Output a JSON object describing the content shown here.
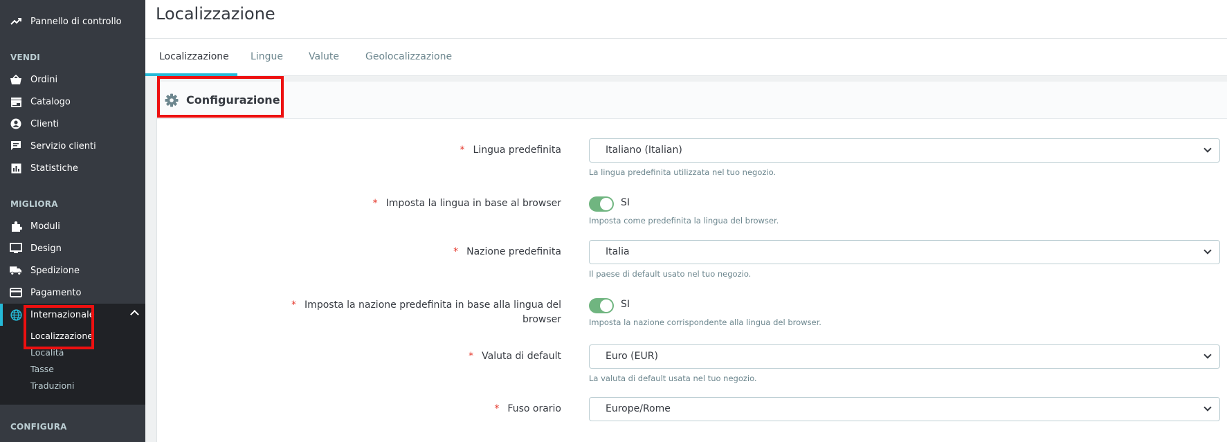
{
  "sidebar": {
    "dashboard": "Pannello di controllo",
    "sections": {
      "sell": "VENDI",
      "improve": "MIGLIORA",
      "configure": "CONFIGURA"
    },
    "sell_items": [
      {
        "label": "Ordini",
        "icon": "basket-icon"
      },
      {
        "label": "Catalogo",
        "icon": "store-icon"
      },
      {
        "label": "Clienti",
        "icon": "user-circle-icon"
      },
      {
        "label": "Servizio clienti",
        "icon": "chat-icon"
      },
      {
        "label": "Statistiche",
        "icon": "bar-chart-icon"
      }
    ],
    "improve_items": [
      {
        "label": "Moduli",
        "icon": "puzzle-icon"
      },
      {
        "label": "Design",
        "icon": "monitor-icon"
      },
      {
        "label": "Spedizione",
        "icon": "truck-icon"
      },
      {
        "label": "Pagamento",
        "icon": "credit-card-icon"
      },
      {
        "label": "Internazionale",
        "icon": "globe-icon"
      }
    ],
    "international_sub": [
      "Localizzazione",
      "Località",
      "Tasse",
      "Traduzioni"
    ]
  },
  "header": {
    "title": "Localizzazione"
  },
  "tabs": [
    "Localizzazione",
    "Lingue",
    "Valute",
    "Geolocalizzazione"
  ],
  "panel": {
    "title": "Configurazione",
    "required_mark": "*",
    "fields": {
      "default_language": {
        "label": "Lingua predefinita",
        "value": "Italiano (Italian)",
        "help": "La lingua predefinita utilizzata nel tuo negozio."
      },
      "browser_language": {
        "label": "Imposta la lingua in base al browser",
        "value": "SI",
        "help": "Imposta come predefinita la lingua del browser."
      },
      "default_country": {
        "label": "Nazione predefinita",
        "value": "Italia",
        "help": "Il paese di default usato nel tuo negozio."
      },
      "browser_country": {
        "label_line1": "Imposta la nazione predefinita in base alla lingua del",
        "label_line2": "browser",
        "value": "SI",
        "help": "Imposta la nazione corrispondente alla lingua del browser."
      },
      "default_currency": {
        "label": "Valuta di default",
        "value": "Euro (EUR)",
        "help": "La valuta di default usata nel tuo negozio."
      },
      "timezone": {
        "label": "Fuso orario",
        "value": "Europe/Rome"
      }
    }
  },
  "colors": {
    "sidebar_bg": "#363a41",
    "sidebar_sub_bg": "#202226",
    "accent": "#25b9d7",
    "toggle_on": "#70b580",
    "required": "#e5372b",
    "highlight_box": "#ed1010"
  }
}
